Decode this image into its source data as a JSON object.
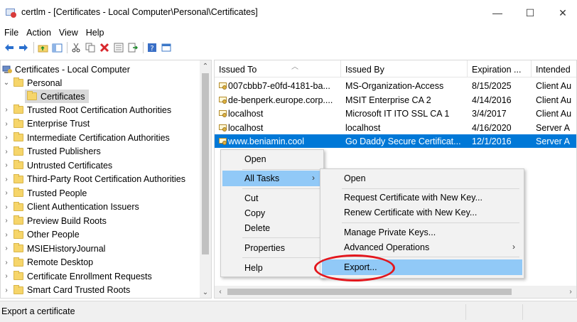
{
  "window": {
    "title": "certlm - [Certificates - Local Computer\\Personal\\Certificates]",
    "minimize": "—",
    "maximize": "☐",
    "close": "✕"
  },
  "menubar": [
    "File",
    "Action",
    "View",
    "Help"
  ],
  "toolbar": {
    "icons": [
      "back-arrow-icon",
      "forward-arrow-icon",
      "up-folder-icon",
      "show-tree-icon",
      "cut-icon",
      "copy-icon",
      "delete-icon",
      "properties-icon",
      "export-list-icon",
      "help-icon",
      "console-view-icon"
    ]
  },
  "tree": {
    "root": "Certificates - Local Computer",
    "personal": "Personal",
    "certificates": "Certificates",
    "items": [
      "Trusted Root Certification Authorities",
      "Enterprise Trust",
      "Intermediate Certification Authorities",
      "Trusted Publishers",
      "Untrusted Certificates",
      "Third-Party Root Certification Authorities",
      "Trusted People",
      "Client Authentication Issuers",
      "Preview Build Roots",
      "Other People",
      "MSIEHistoryJournal",
      "Remote Desktop",
      "Certificate Enrollment Requests",
      "Smart Card Trusted Roots"
    ]
  },
  "list": {
    "columns": [
      "Issued To",
      "Issued By",
      "Expiration ...",
      "Intended"
    ],
    "rows": [
      {
        "issued_to": "007cbbb7-e0fd-4181-ba...",
        "issued_by": "MS-Organization-Access",
        "expiration": "8/15/2025",
        "intended": "Client Au"
      },
      {
        "issued_to": "de-benperk.europe.corp....",
        "issued_by": "MSIT Enterprise CA 2",
        "expiration": "4/14/2016",
        "intended": "Client Au"
      },
      {
        "issued_to": "localhost",
        "issued_by": "Microsoft IT ITO SSL CA 1",
        "expiration": "3/4/2017",
        "intended": "Client Au"
      },
      {
        "issued_to": "localhost",
        "issued_by": "localhost",
        "expiration": "4/16/2020",
        "intended": "Server A"
      },
      {
        "issued_to": "www.beniamin.cool",
        "issued_by": "Go Daddy Secure Certificat...",
        "expiration": "12/1/2016",
        "intended": "Server A"
      }
    ]
  },
  "context_menu": {
    "open": "Open",
    "all_tasks": "All Tasks",
    "cut": "Cut",
    "copy": "Copy",
    "delete": "Delete",
    "properties": "Properties",
    "help": "Help"
  },
  "submenu": {
    "open": "Open",
    "request_new_key": "Request Certificate with New Key...",
    "renew_new_key": "Renew Certificate with New Key...",
    "manage_private_keys": "Manage Private Keys...",
    "advanced_operations": "Advanced Operations",
    "export": "Export..."
  },
  "status": "Export a certificate",
  "colors": {
    "selection_blue": "#0078d7",
    "menu_highlight": "#91c9f7",
    "annotation_red": "#e3161c"
  }
}
